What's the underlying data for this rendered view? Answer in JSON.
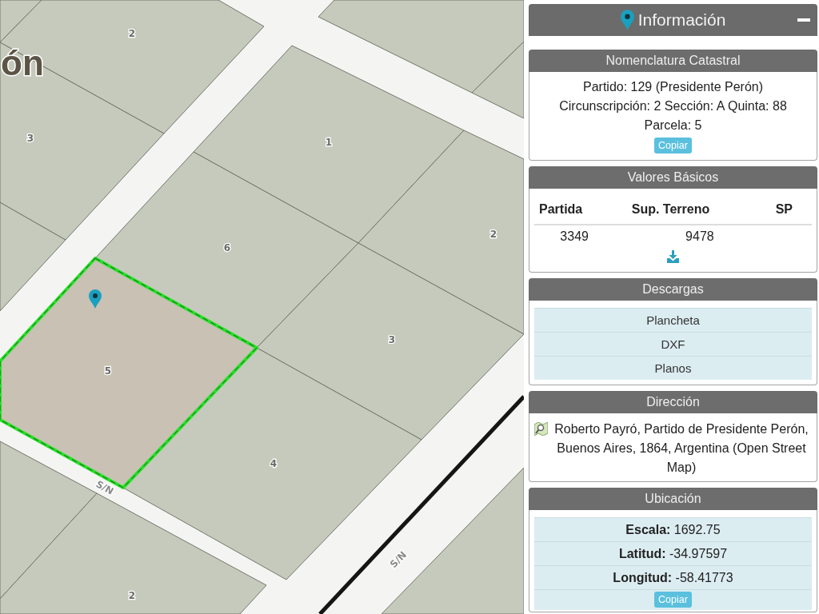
{
  "map": {
    "place_label": "ón",
    "parcels": [
      {
        "label": "2",
        "selected": false
      },
      {
        "label": "3",
        "selected": false
      },
      {
        "label": "1",
        "selected": false
      },
      {
        "label": "2",
        "selected": false
      },
      {
        "label": "6",
        "selected": false
      },
      {
        "label": "3",
        "selected": false
      },
      {
        "label": "5",
        "selected": true
      },
      {
        "label": "4",
        "selected": false
      },
      {
        "label": "2",
        "selected": false
      }
    ],
    "street_labels": [
      "S/N",
      "S/N"
    ]
  },
  "panel": {
    "title": "Información",
    "sections": [
      {
        "kind": "lines",
        "title": "Nomenclatura Catastral",
        "lines": [
          "Partido: 129 (Presidente Perón)",
          "Circunscripción: 2 Sección: A Quinta: 88",
          "Parcela: 5"
        ],
        "button": "Copiar"
      },
      {
        "kind": "table",
        "title": "Valores Básicos",
        "columns": [
          "Partida",
          "Sup. Terreno",
          "SP"
        ],
        "rows": [
          [
            "3349",
            "9478"
          ]
        ]
      },
      {
        "kind": "links",
        "title": "Descargas",
        "items": [
          "Plancheta",
          "DXF",
          "Planos"
        ]
      },
      {
        "kind": "address",
        "title": "Dirección",
        "text": "Roberto Payró, Partido de Presidente Perón, Buenos Aires, 1864, Argentina (Open Street Map)"
      },
      {
        "kind": "fields",
        "title": "Ubicación",
        "rows": [
          "**Escala:** 1692.75",
          "**Latitud:** -34.97597",
          "**Longitud:** -58.41773"
        ],
        "button": "Copiar"
      }
    ]
  }
}
